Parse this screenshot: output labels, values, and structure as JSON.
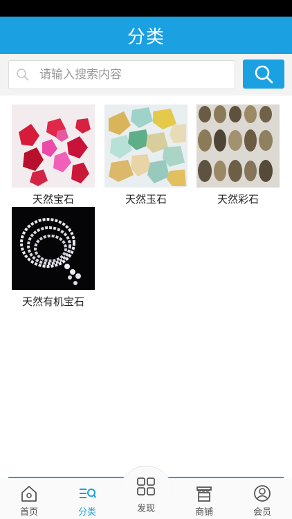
{
  "header": {
    "title": "分类"
  },
  "search": {
    "placeholder": "请输入搜索内容",
    "value": ""
  },
  "categories": [
    {
      "label": "天然宝石"
    },
    {
      "label": "天然玉石"
    },
    {
      "label": "天然彩石"
    },
    {
      "label": "天然有机宝石"
    }
  ],
  "tabbar": {
    "items": [
      {
        "label": "首页",
        "icon": "home-icon"
      },
      {
        "label": "分类",
        "icon": "category-icon",
        "active": true
      },
      {
        "label": "发现",
        "icon": "discover-grid-icon"
      },
      {
        "label": "商铺",
        "icon": "store-icon"
      },
      {
        "label": "会员",
        "icon": "member-icon"
      }
    ]
  },
  "colors": {
    "accent": "#1ba1e2",
    "status_bar": "#000000",
    "search_bg": "#f3f3f3"
  }
}
